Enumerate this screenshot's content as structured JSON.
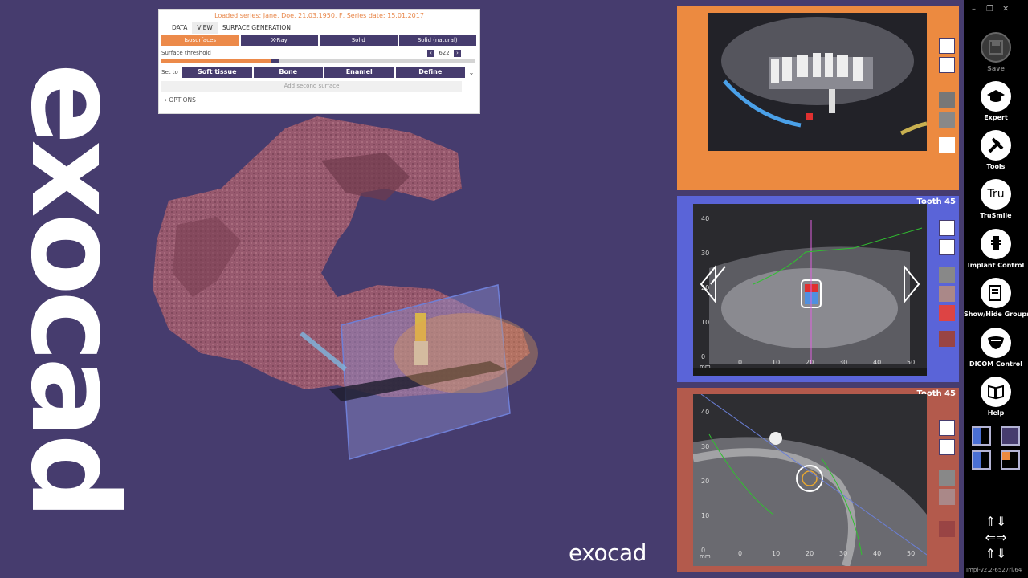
{
  "brand": {
    "vertical_logo": "exocad",
    "bottom_logo": "exocad"
  },
  "panel": {
    "title": "Loaded series: Jane, Doe, 21.03.1950, F, Series date: 15.01.2017",
    "tabs": [
      "DATA",
      "VIEW",
      "SURFACE GENERATION"
    ],
    "active_tab": "VIEW",
    "modes": [
      "Isosurfaces",
      "X-Ray",
      "Solid",
      "Solid (natural)"
    ],
    "active_mode": "Isosurfaces",
    "threshold_label": "Surface threshold",
    "threshold_value": "622",
    "threshold_fraction": 0.35,
    "set_to_label": "Set to",
    "set_buttons": [
      "Soft tissue",
      "Bone",
      "Enamel",
      "Define"
    ],
    "add_second": "Add second surface",
    "options": "OPTIONS"
  },
  "viewports": {
    "top": {
      "label": ""
    },
    "middle": {
      "label": "Tooth 45",
      "axis_unit": "mm",
      "x_ticks": [
        "0",
        "10",
        "20",
        "30",
        "40",
        "50"
      ],
      "y_ticks": [
        "40",
        "30",
        "20",
        "10",
        "0"
      ]
    },
    "bottom": {
      "label": "Tooth 45",
      "axis_unit": "mm",
      "x_ticks": [
        "0",
        "10",
        "20",
        "30",
        "40",
        "50"
      ],
      "y_ticks": [
        "40",
        "30",
        "20",
        "10",
        "0"
      ]
    }
  },
  "toolbar": {
    "items": [
      {
        "label": "Save",
        "icon": "save-icon",
        "enabled": false
      },
      {
        "label": "Expert",
        "icon": "graduation-cap-icon",
        "enabled": true
      },
      {
        "label": "Tools",
        "icon": "tools-icon",
        "enabled": true
      },
      {
        "label": "TruSmile",
        "icon": "trusmile-icon",
        "enabled": true,
        "icon_text": "Tru"
      },
      {
        "label": "Implant Control",
        "icon": "implant-icon",
        "enabled": true
      },
      {
        "label": "Show/Hide Groups",
        "icon": "groups-icon",
        "enabled": true
      },
      {
        "label": "DICOM Control",
        "icon": "dicom-icon",
        "enabled": true
      },
      {
        "label": "Help",
        "icon": "help-book-icon",
        "enabled": true
      }
    ]
  },
  "version": "Impl-v2.2-6527rl/64",
  "colors": {
    "background": "#463c6e",
    "accent_orange": "#ec8a40",
    "viewport_blue": "#5a64d8",
    "viewport_red": "#b35a4c"
  }
}
